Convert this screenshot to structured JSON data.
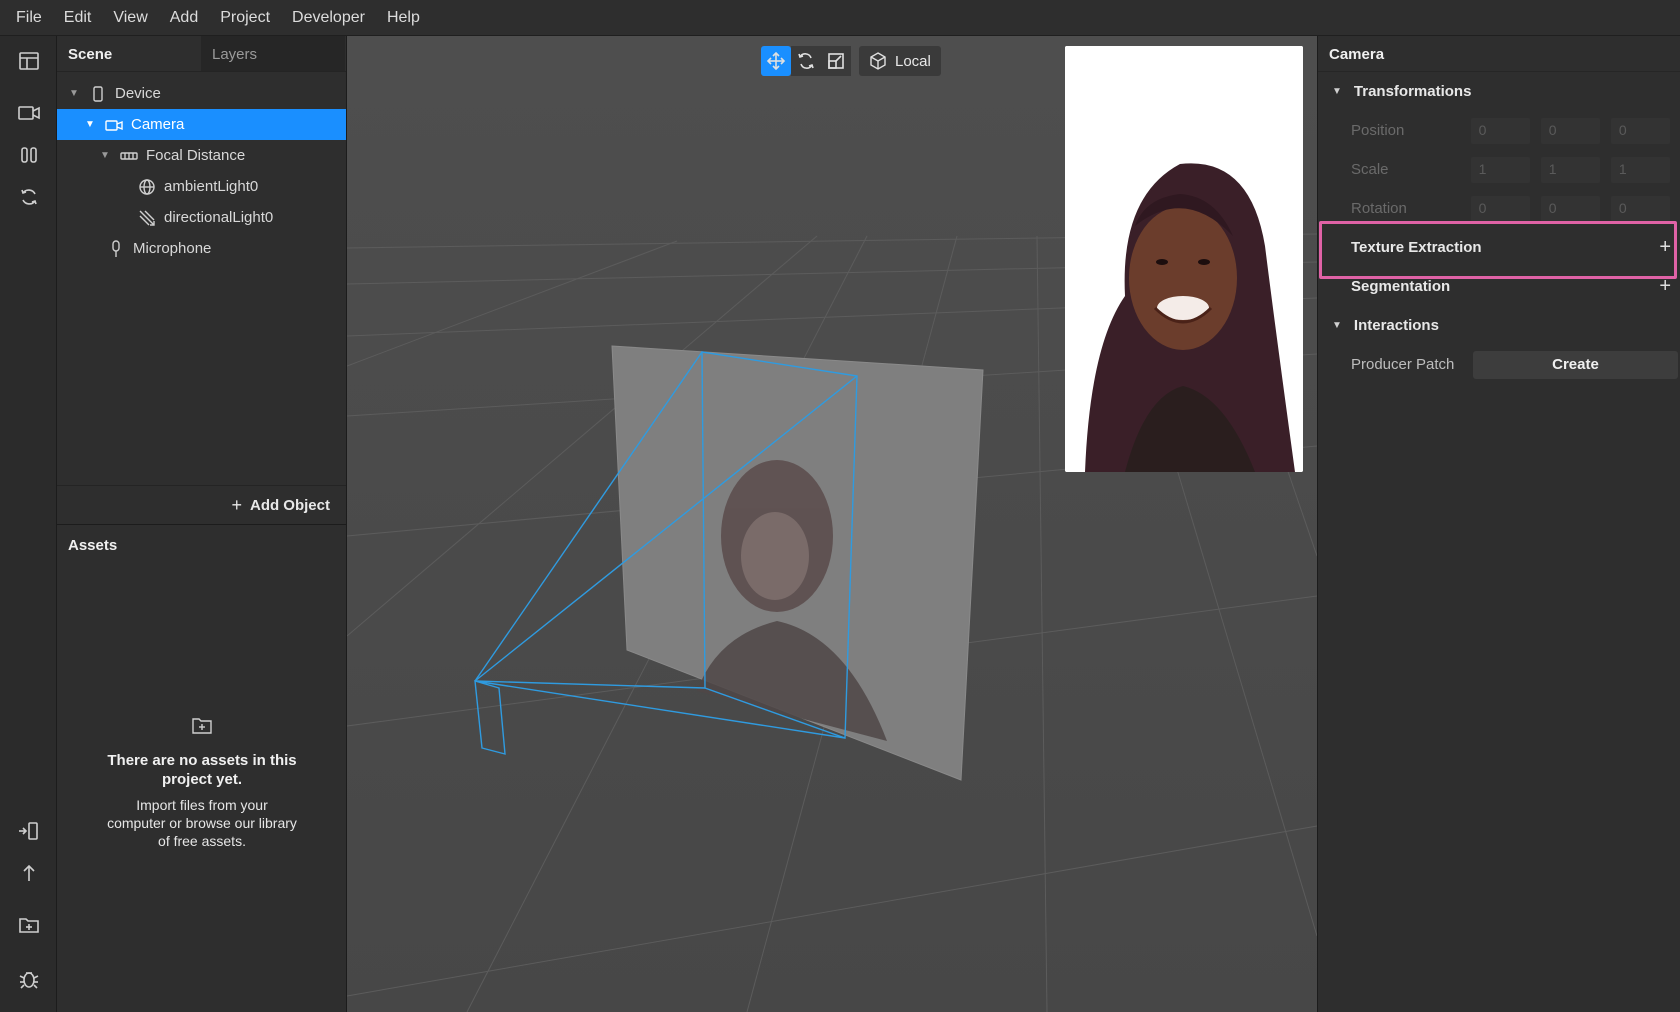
{
  "menu": [
    "File",
    "Edit",
    "View",
    "Add",
    "Project",
    "Developer",
    "Help"
  ],
  "scene_panel": {
    "tabs": [
      "Scene",
      "Layers"
    ],
    "tree": [
      {
        "label": "Device",
        "icon": "device-icon"
      },
      {
        "label": "Camera",
        "icon": "camera-icon",
        "selected": true
      },
      {
        "label": "Focal Distance",
        "icon": "focal-distance-icon"
      },
      {
        "label": "ambientLight0",
        "icon": "ambient-light-icon"
      },
      {
        "label": "directionalLight0",
        "icon": "directional-light-icon"
      },
      {
        "label": "Microphone",
        "icon": "microphone-icon"
      }
    ],
    "add_object_label": "Add Object",
    "add_object_plus": "+"
  },
  "assets_panel": {
    "title": "Assets",
    "empty_title": "There are no assets in this project yet.",
    "empty_line1": "Import files from your",
    "empty_line2": "computer or browse our library",
    "empty_line3": "of free assets."
  },
  "viewport": {
    "mode_label": "Local",
    "tools": [
      "move-tool-icon",
      "rotate-tool-icon",
      "scale-tool-icon"
    ],
    "accent": "#1a8fff",
    "frustum_color": "#2f9be0"
  },
  "inspector": {
    "title": "Camera",
    "transformations": {
      "label": "Transformations",
      "position_label": "Position",
      "position": [
        "0",
        "0",
        "0"
      ],
      "scale_label": "Scale",
      "scale": [
        "1",
        "1",
        "1"
      ],
      "rotation_label": "Rotation",
      "rotation": [
        "0",
        "0",
        "0"
      ]
    },
    "texture_extraction": "Texture Extraction",
    "segmentation": "Segmentation",
    "add_plus": "+",
    "interactions": {
      "label": "Interactions",
      "producer_patch_label": "Producer Patch",
      "create_button": "Create"
    },
    "highlight_color": "#e062a6"
  }
}
